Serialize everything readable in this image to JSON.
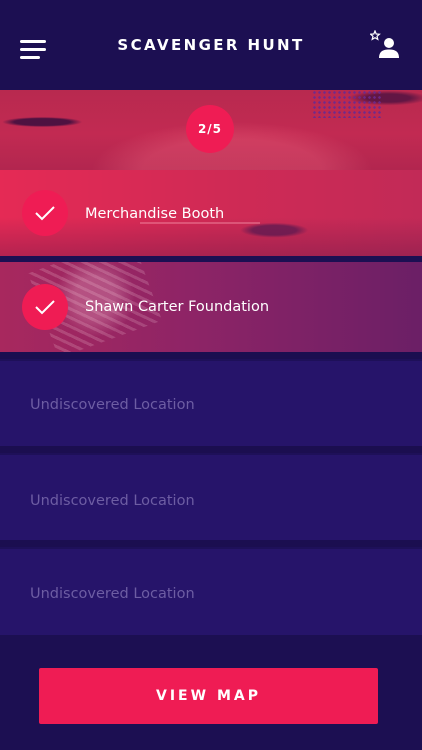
{
  "header": {
    "title": "SCAVENGER HUNT",
    "menu_icon": "hamburger-menu-icon",
    "profile_icon": "favorite-user-icon"
  },
  "progress": {
    "label": "2/5",
    "found": 2,
    "total": 5
  },
  "locations": [
    {
      "name": "Merchandise Booth",
      "status": "found"
    },
    {
      "name": "Shawn Carter Foundation",
      "status": "found"
    },
    {
      "name": "Undiscovered Location",
      "status": "undiscovered"
    },
    {
      "name": "Undiscovered Location",
      "status": "undiscovered"
    },
    {
      "name": "Undiscovered Location",
      "status": "undiscovered"
    }
  ],
  "footer": {
    "view_map_label": "VIEW MAP"
  },
  "colors": {
    "background": "#1c0f52",
    "accent": "#ef1c54",
    "undiscovered_row": "#26146a",
    "undiscovered_text": "#6d5da3"
  }
}
